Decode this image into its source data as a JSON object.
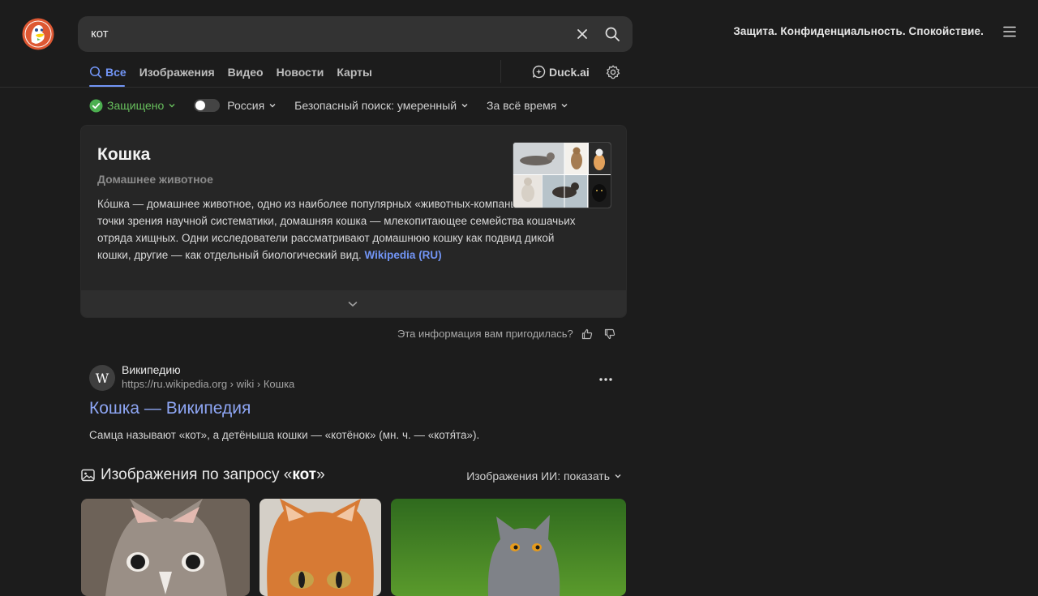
{
  "search": {
    "query": "кот"
  },
  "header": {
    "tagline": "Защита. Конфиденциальность. Спокойствие."
  },
  "tabs": [
    {
      "label": "Все",
      "active": true
    },
    {
      "label": "Изображения"
    },
    {
      "label": "Видео"
    },
    {
      "label": "Новости"
    },
    {
      "label": "Карты"
    }
  ],
  "duckai": {
    "label": "Duck.ai"
  },
  "filters": {
    "protected": "Защищено",
    "region": "Россия",
    "safe_search": "Безопасный поиск: умеренный",
    "time": "За всё время"
  },
  "panel": {
    "title": "Кошка",
    "subtitle": "Домашнее животное",
    "text": "Ко́шка — домашнее животное, одно из наиболее популярных «животных-компаньонов». С точки зрения научной систематики, домашняя кошка — млекопитающее семейства кошачьих отряда хищных. Одни исследователи рассматривают домашнюю кошку как подвид дикой кошки, другие — как отдельный биологический вид.",
    "source": "Wikipedia (RU)"
  },
  "feedback": {
    "question": "Эта информация вам пригодилась?"
  },
  "result": {
    "site": "Википедию",
    "url": "https://ru.wikipedia.org › wiki › Кошка",
    "title": "Кошка — Википедия",
    "snippet": "Самца называют «кот», а детёныша кошки — «котёнок» (мн. ч. — «котя́та»)."
  },
  "images_section": {
    "prefix": "Изображения по запросу «",
    "query": "кот",
    "suffix": "»",
    "ai_toggle": "Изображения ИИ: показать"
  },
  "colors": {
    "accent": "#7295f6",
    "protected": "#68c05d",
    "background": "#1c1c1c"
  }
}
